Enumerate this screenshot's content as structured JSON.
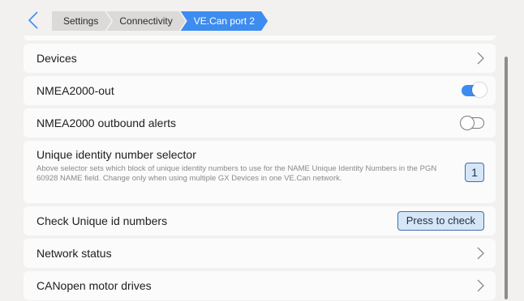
{
  "breadcrumb": {
    "items": [
      "Settings",
      "Connectivity",
      "VE.Can port 2"
    ]
  },
  "icons": {
    "back": "chevron-left-icon",
    "chevron": "chevron-right-icon"
  },
  "rows": {
    "devices": {
      "label": "Devices"
    },
    "nmea_out": {
      "label": "NMEA2000-out",
      "state": "on"
    },
    "nmea_alerts": {
      "label": "NMEA2000 outbound alerts",
      "state": "off"
    },
    "unique_selector": {
      "label": "Unique identity number selector",
      "description": "Above selector sets which block of unique identity numbers to use for the NAME Unique Identity Numbers in the PGN 60928 NAME field. Change only when using multiple GX Devices in one VE.Can network.",
      "value": "1"
    },
    "check_unique": {
      "label": "Check Unique id numbers",
      "button": "Press to check"
    },
    "network_status": {
      "label": "Network status"
    },
    "canopen": {
      "label": "CANopen motor drives"
    }
  },
  "colors": {
    "accent": "#3d8cf0",
    "background": "#f2f1f0",
    "row": "#fbfbfb"
  }
}
